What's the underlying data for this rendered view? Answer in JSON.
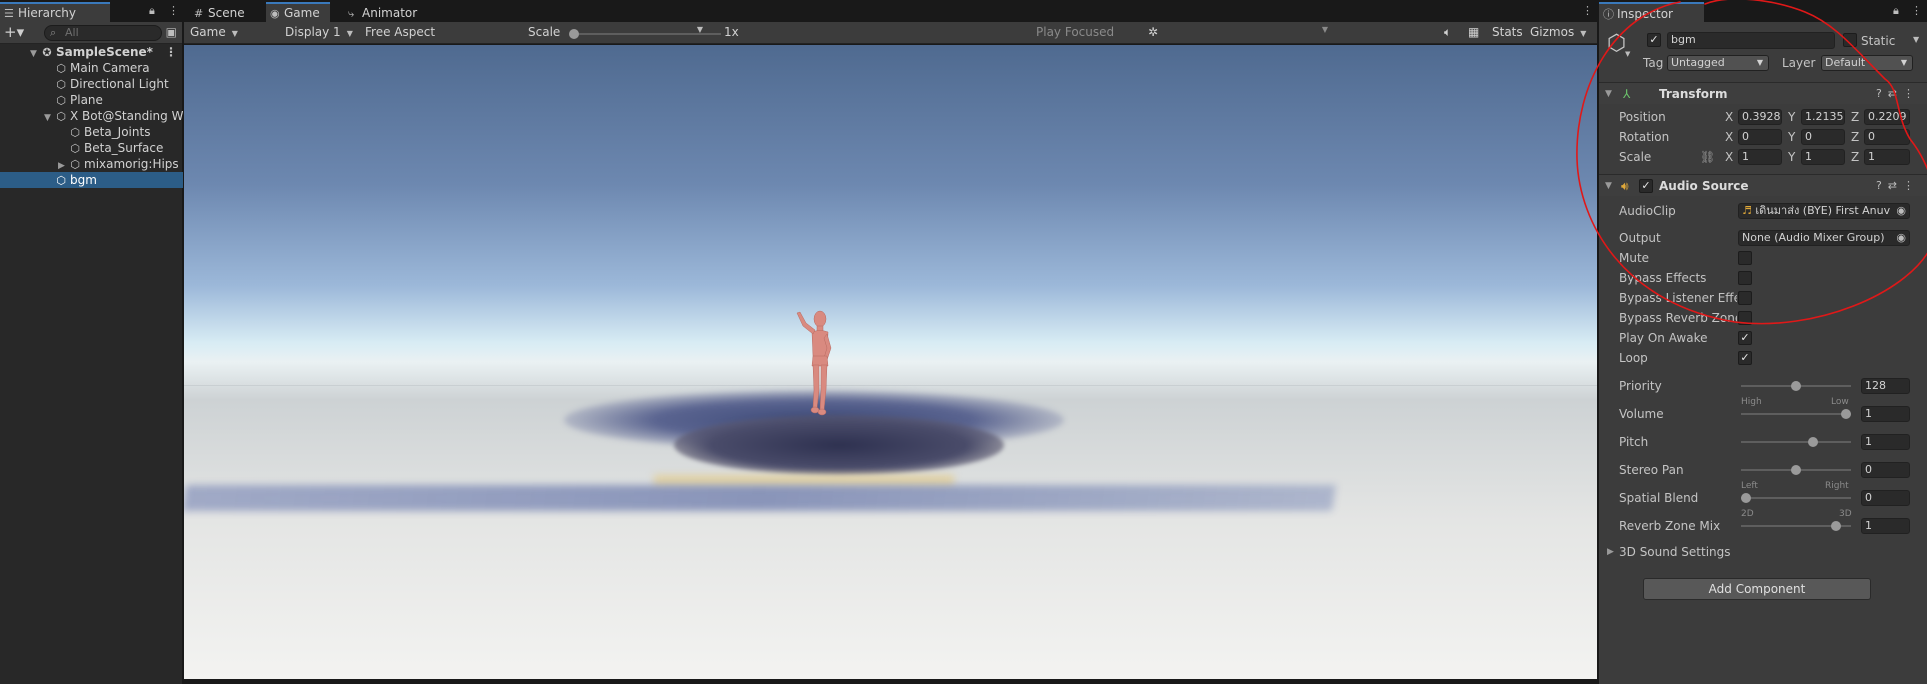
{
  "hierarchy": {
    "tab_label": "Hierarchy",
    "search_placeholder": "All",
    "items": [
      {
        "label": "SampleScene*",
        "kind": "scene"
      },
      {
        "label": "Main Camera"
      },
      {
        "label": "Directional Light"
      },
      {
        "label": "Plane"
      },
      {
        "label": "X Bot@Standing Wa"
      },
      {
        "label": "Beta_Joints"
      },
      {
        "label": "Beta_Surface"
      },
      {
        "label": "mixamorig:Hips"
      },
      {
        "label": "bgm",
        "selected": true
      }
    ]
  },
  "game_view": {
    "tabs": [
      "Scene",
      "Game",
      "Animator"
    ],
    "active_tab": "Game",
    "toolbar": {
      "view_mode": "Game",
      "display": "Display 1",
      "aspect": "Free Aspect",
      "scale_label": "Scale",
      "scale_value": "1x",
      "play_mode": "Play Focused",
      "stats": "Stats",
      "gizmos": "Gizmos"
    }
  },
  "inspector": {
    "tab_label": "Inspector",
    "object_name": "bgm",
    "active": true,
    "static_label": "Static",
    "tag_label": "Tag",
    "tag_value": "Untagged",
    "layer_label": "Layer",
    "layer_value": "Default",
    "transform": {
      "title": "Transform",
      "rows": [
        {
          "label": "Position",
          "x": "0.3928",
          "y": "1.21358",
          "z": "0.2209"
        },
        {
          "label": "Rotation",
          "x": "0",
          "y": "0",
          "z": "0"
        },
        {
          "label": "Scale",
          "x": "1",
          "y": "1",
          "z": "1"
        }
      ]
    },
    "audio_source": {
      "title": "Audio Source",
      "enabled": true,
      "audio_clip_label": "AudioClip",
      "audio_clip_value": "เดินมาส่ง (BYE) First Anuv",
      "output_label": "Output",
      "output_value": "None (Audio Mixer Group)",
      "toggles": [
        {
          "label": "Mute",
          "checked": false
        },
        {
          "label": "Bypass Effects",
          "checked": false
        },
        {
          "label": "Bypass Listener Effec",
          "checked": false
        },
        {
          "label": "Bypass Reverb Zones",
          "checked": false
        },
        {
          "label": "Play On Awake",
          "checked": true
        },
        {
          "label": "Loop",
          "checked": true
        }
      ],
      "sliders": [
        {
          "label": "Priority",
          "value": "128",
          "fraction": 0.5,
          "left_hint": "High",
          "right_hint": "Low"
        },
        {
          "label": "Volume",
          "value": "1",
          "fraction": 1.0
        },
        {
          "label": "Pitch",
          "value": "1",
          "fraction": 0.67
        },
        {
          "label": "Stereo Pan",
          "value": "0",
          "fraction": 0.5,
          "left_hint": "Left",
          "right_hint": "Right"
        },
        {
          "label": "Spatial Blend",
          "value": "0",
          "fraction": 0.0,
          "left_hint": "2D",
          "right_hint": "3D"
        },
        {
          "label": "Reverb Zone Mix",
          "value": "1",
          "fraction": 0.9
        }
      ],
      "sound_settings_label": "3D Sound Settings"
    },
    "add_component_label": "Add Component"
  },
  "colors": {
    "selection": "#2c5d87",
    "annotation": "#e01818",
    "character": "#d98a80"
  }
}
